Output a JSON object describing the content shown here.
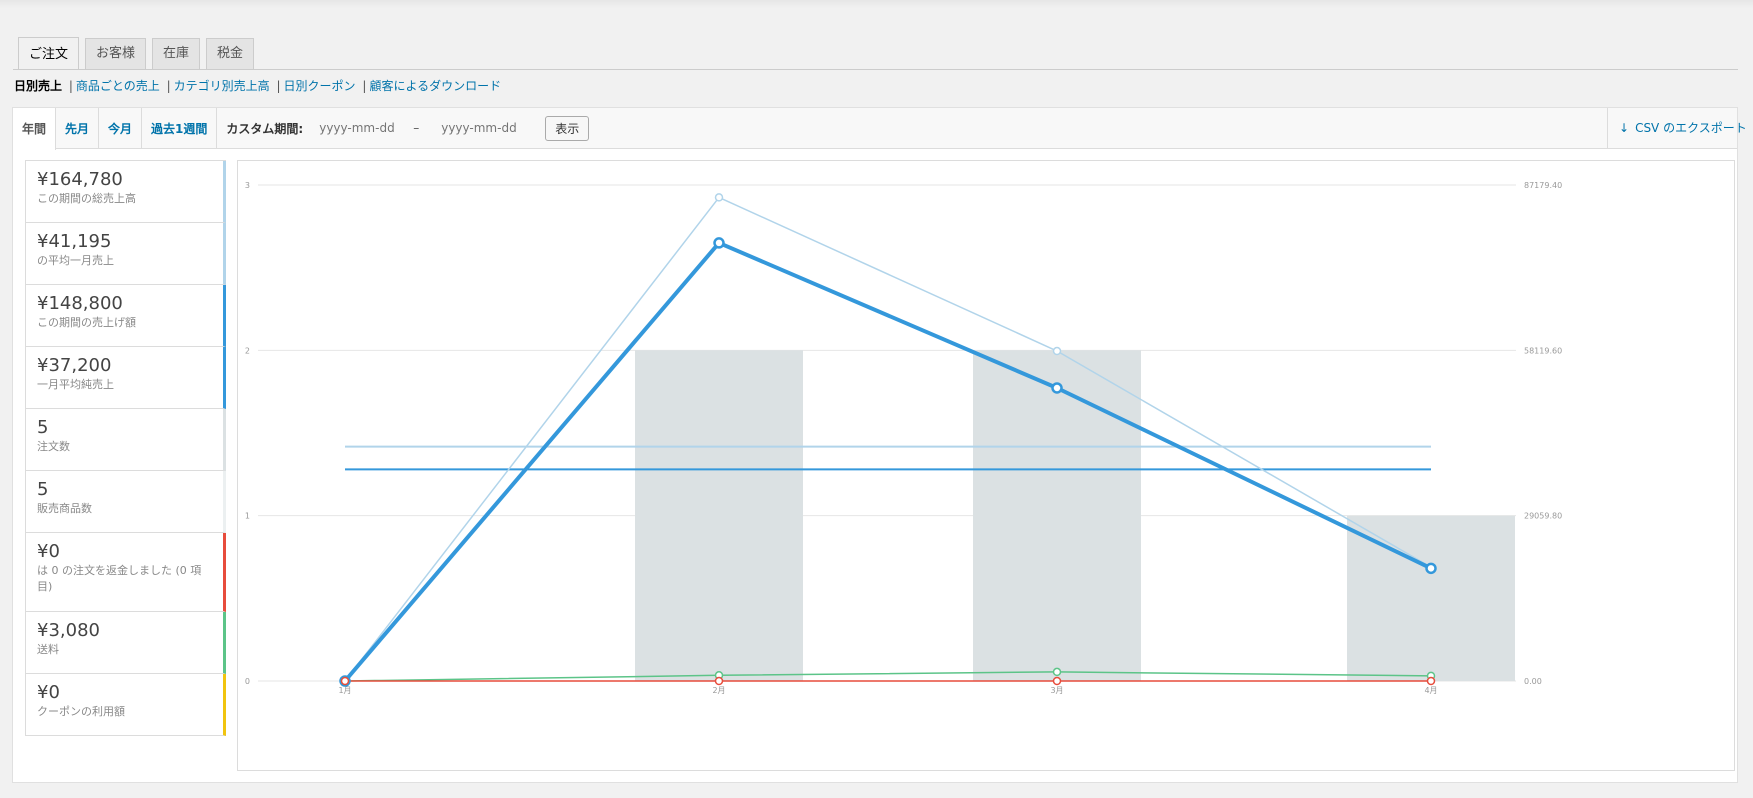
{
  "main_tabs": [
    {
      "label": "ご注文",
      "active": true
    },
    {
      "label": "お客様",
      "active": false
    },
    {
      "label": "在庫",
      "active": false
    },
    {
      "label": "税金",
      "active": false
    }
  ],
  "subnav": {
    "current": "日別売上",
    "links": [
      "商品ごとの売上",
      "カテゴリ別売上高",
      "日別クーポン",
      "顧客によるダウンロード"
    ]
  },
  "range_tabs": [
    {
      "label": "年間",
      "active": true
    },
    {
      "label": "先月",
      "active": false
    },
    {
      "label": "今月",
      "active": false
    },
    {
      "label": "過去1週間",
      "active": false
    }
  ],
  "custom_range": {
    "label": "カスタム期間:",
    "from_placeholder": "yyyy-mm-dd",
    "separator": "–",
    "to_placeholder": "yyyy-mm-dd",
    "button": "表示"
  },
  "export": {
    "label": "CSV のエクスポート",
    "icon": "download-arrow-icon"
  },
  "legend": [
    {
      "amount": "¥164,780",
      "desc": "この期間の総売上高",
      "color": "#b1d4ea"
    },
    {
      "amount": "¥41,195",
      "desc": "の平均一月売上",
      "color": "#b1d4ea"
    },
    {
      "amount": "¥148,800",
      "desc": "この期間の売上げ額",
      "color": "#3498db"
    },
    {
      "amount": "¥37,200",
      "desc": "一月平均純売上",
      "color": "#3498db"
    },
    {
      "amount": "5",
      "desc": "注文数",
      "color": "#dbe1e3"
    },
    {
      "amount": "5",
      "desc": "販売商品数",
      "color": "#ecf0f1"
    },
    {
      "amount": "¥0",
      "desc": "は 0 の注文を返金しました (0 項目)",
      "color": "#e74c3c"
    },
    {
      "amount": "¥3,080",
      "desc": "送料",
      "color": "#5cc488"
    },
    {
      "amount": "¥0",
      "desc": "クーポンの利用額",
      "color": "#f1c40f"
    }
  ],
  "chart_data": {
    "type": "line",
    "categories": [
      "1月",
      "2月",
      "3月",
      "4月"
    ],
    "left_axis": {
      "ticks": [
        "0",
        "1",
        "2",
        "3"
      ],
      "range": [
        0,
        3
      ]
    },
    "right_axis": {
      "ticks": [
        "0.00",
        "29059.80",
        "58119.60",
        "87179.40"
      ],
      "range": [
        0,
        87179.4
      ]
    },
    "bars": {
      "name": "",
      "values": [
        0,
        2,
        2,
        1
      ],
      "color": "#dbe1e3"
    },
    "series": [
      {
        "values": [
          0,
          85000,
          58000,
          20000
        ],
        "color": "#b1d4ea"
      },
      {
        "values": [
          0,
          77000,
          51500,
          19800
        ],
        "color": "#3498db"
      },
      {
        "values": [
          0,
          1000,
          1600,
          900
        ],
        "color": "#5cc488"
      },
      {
        "values": [
          0,
          0,
          0,
          0
        ],
        "color": "#e74c3c"
      }
    ],
    "averages": [
      {
        "value": 41195,
        "color": "#b1d4ea"
      },
      {
        "value": 37200,
        "color": "#3498db"
      }
    ],
    "grid": true
  }
}
